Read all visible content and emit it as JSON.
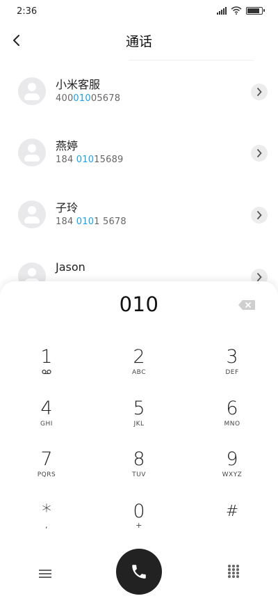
{
  "status_bar": {
    "time": "2:36",
    "icons": [
      "signal-icon",
      "wifi-icon",
      "battery-icon"
    ],
    "battery_level": 0.9
  },
  "header": {
    "title": "通话",
    "back_icon": "chevron-left-icon"
  },
  "contacts": [
    {
      "name": "小米客服",
      "number_pre": "400",
      "number_match": "010",
      "number_post": "05678"
    },
    {
      "name": "燕婷",
      "number_pre": "184 ",
      "number_match": "010",
      "number_post": "15689"
    },
    {
      "name": "子玲",
      "number_pre": "184 ",
      "number_match": "010",
      "number_post": "1 5678"
    },
    {
      "name": "Jason",
      "number_pre": "",
      "number_match": "",
      "number_post": ""
    }
  ],
  "dialer": {
    "input": "010",
    "keys": [
      {
        "digit": "1",
        "letters": ""
      },
      {
        "digit": "2",
        "letters": "ABC"
      },
      {
        "digit": "3",
        "letters": "DEF"
      },
      {
        "digit": "4",
        "letters": "GHI"
      },
      {
        "digit": "5",
        "letters": "JKL"
      },
      {
        "digit": "6",
        "letters": "MNO"
      },
      {
        "digit": "7",
        "letters": "PQRS"
      },
      {
        "digit": "8",
        "letters": "TUV"
      },
      {
        "digit": "9",
        "letters": "WXYZ"
      },
      {
        "digit": "*",
        "letters": ","
      },
      {
        "digit": "0",
        "letters": "+"
      },
      {
        "digit": "#",
        "letters": ""
      }
    ]
  },
  "colors": {
    "match_highlight": "#1aa1e6",
    "call_button": "#222222"
  }
}
